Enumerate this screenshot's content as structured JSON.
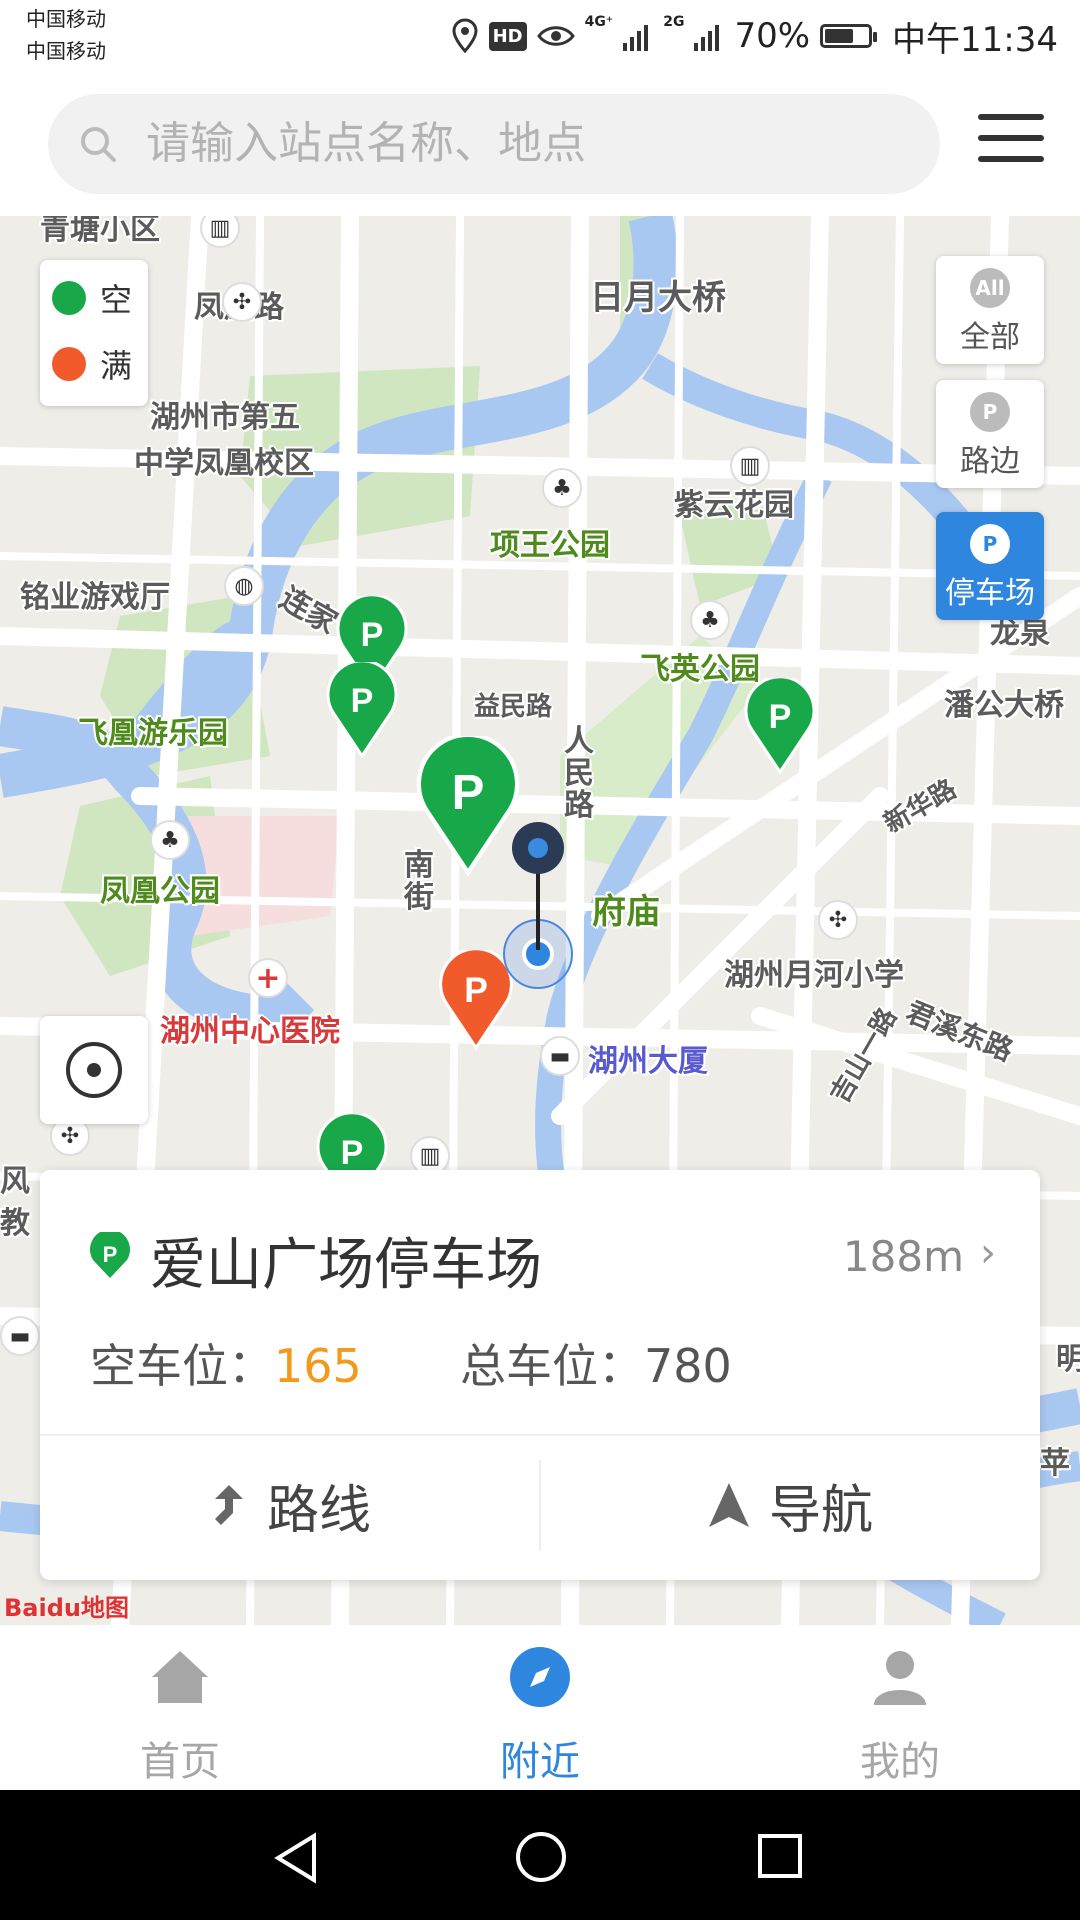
{
  "status_bar": {
    "carrier_1": "中国移动",
    "carrier_2": "中国移动",
    "network_1": "4G⁺",
    "network_2": "2G",
    "hd": "HD",
    "battery": "70%",
    "battery_level": 0.7,
    "time": "中午11:34"
  },
  "search": {
    "placeholder": "请输入站点名称、地点"
  },
  "legend": [
    {
      "label": "空",
      "color": "#18a84a"
    },
    {
      "label": "满",
      "color": "#f15a2b"
    }
  ],
  "filters": [
    {
      "icon_text": "All",
      "label": "全部",
      "active": false
    },
    {
      "icon_text": "P",
      "label": "路边",
      "active": false
    },
    {
      "icon_text": "P",
      "label": "停车场",
      "active": true
    }
  ],
  "map_labels": {
    "qingtang": "青塘小区",
    "fenghuang_road": "凤凰路",
    "riyue_bridge": "日月大桥",
    "school_5_l1": "湖州市第五",
    "school_5_l2": "中学凤凰校区",
    "ziyun_garden": "紫云花园",
    "xiangwang_park": "项王公园",
    "mingye_game": "铭业游戏厅",
    "lianjia": "连家",
    "feiying_park": "飞英公园",
    "longquan": "龙泉",
    "pangong": "潘公大桥",
    "yimin_road": "益民路",
    "feihuang_park": "飞凰游乐园",
    "renmin_road": "人民路",
    "xinhua_road": "新华路",
    "fenghuang_park": "凤凰公园",
    "nanjie": "南街",
    "fumiao": "府庙",
    "yuehe_school": "湖州月河小学",
    "hospital": "湖州中心医院",
    "huzhou_building": "湖州大厦",
    "junxi_road": "君溪东路",
    "jishan": "吉山一路",
    "feng": "风",
    "jiao": "教",
    "ming": "明",
    "ping": "苹"
  },
  "map_watermark": "Baidu地图",
  "card": {
    "title": "爱山广场停车场",
    "distance": "188m",
    "free_label": "空车位：",
    "free_value": "165",
    "total_label": "总车位：",
    "total_value": "780",
    "route_label": "路线",
    "navigate_label": "导航",
    "accent": "#f29a1b"
  },
  "tabs": [
    {
      "label": "首页",
      "icon": "home-icon",
      "active": false
    },
    {
      "label": "附近",
      "icon": "compass-icon",
      "active": true
    },
    {
      "label": "我的",
      "icon": "user-icon",
      "active": false
    }
  ],
  "colors": {
    "primary": "#2e86de",
    "green_pin": "#18a84a",
    "red_pin": "#f15a2b"
  }
}
